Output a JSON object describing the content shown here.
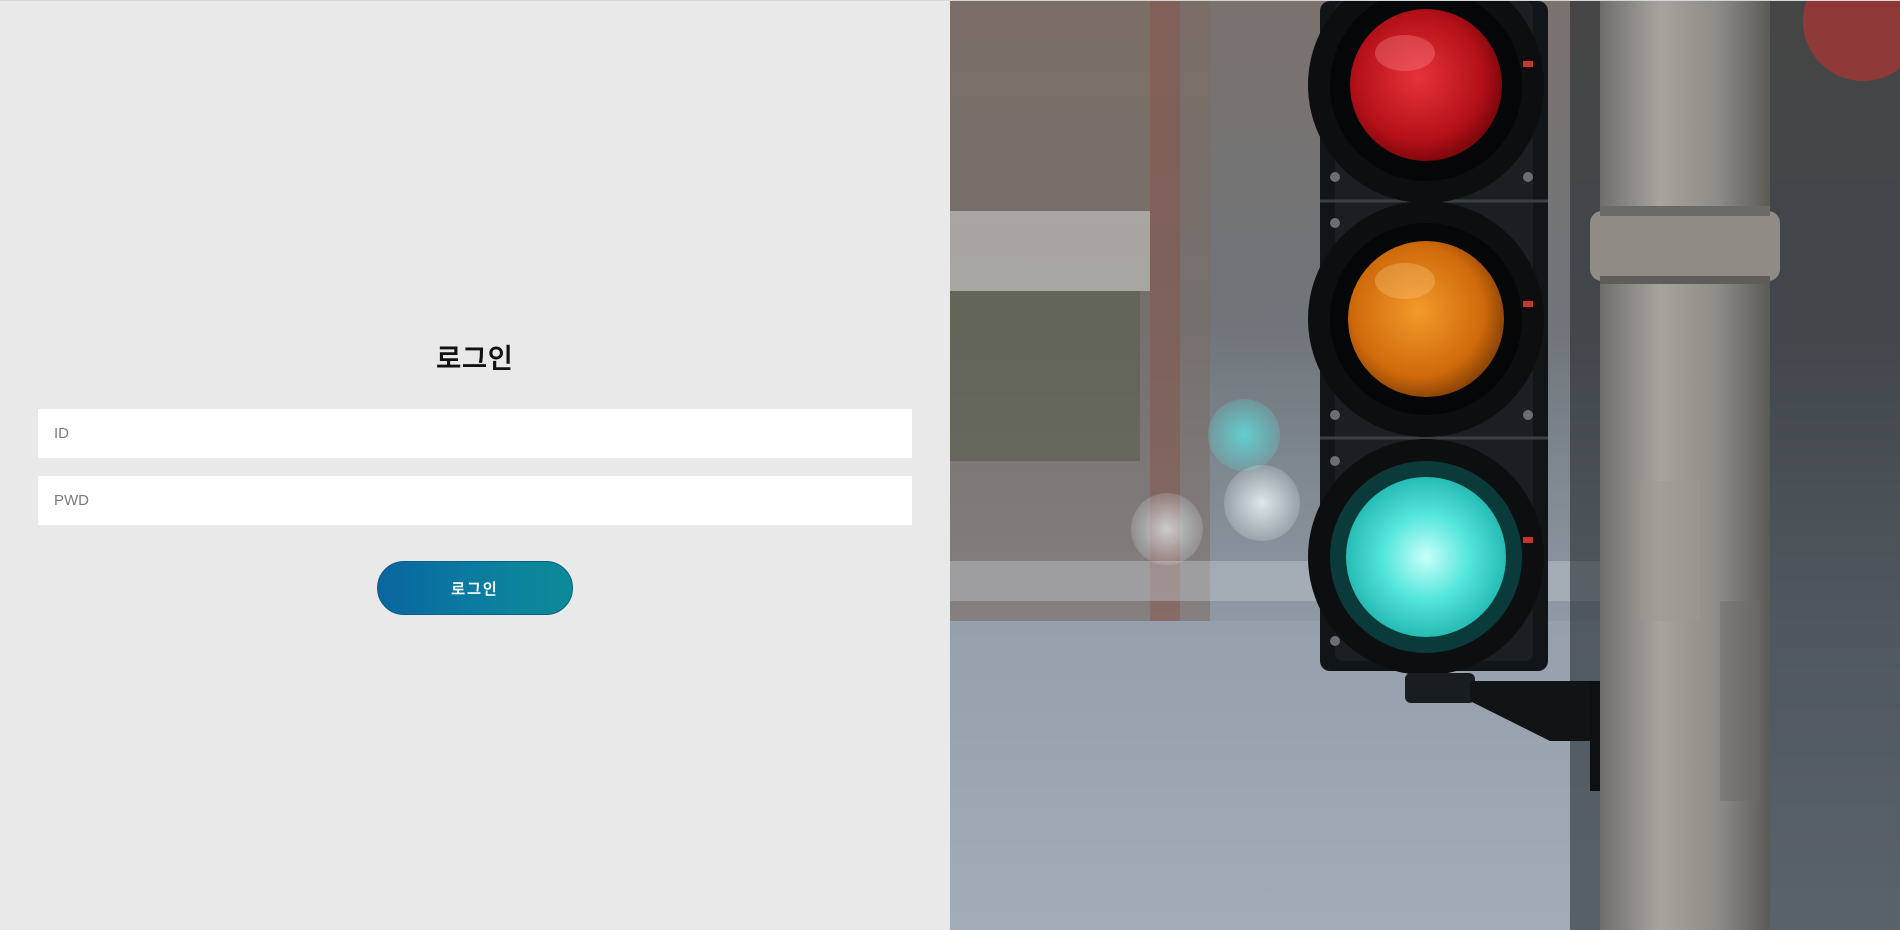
{
  "login": {
    "title": "로그인",
    "id_placeholder": "ID",
    "pwd_placeholder": "PWD",
    "button_label": "로그인"
  },
  "colors": {
    "left_background": "#e9e9e9",
    "button_gradient_start": "#0a659f",
    "button_gradient_end": "#0c8b98",
    "light_red": "#d11a1f",
    "light_amber": "#e17a0e",
    "light_green": "#3fe0d6"
  },
  "hero": {
    "icon": "traffic-light-image"
  }
}
